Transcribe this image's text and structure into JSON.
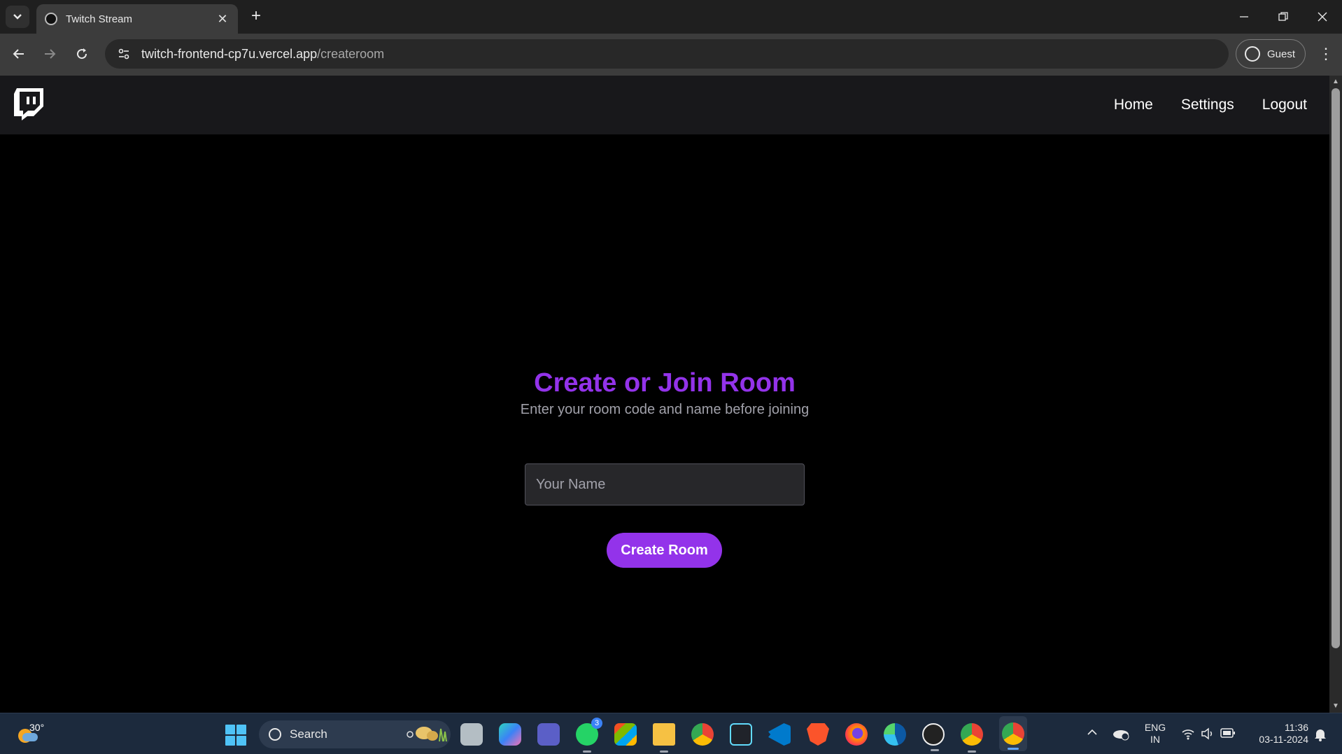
{
  "browser": {
    "tab_title": "Twitch Stream",
    "url_host": "twitch-frontend-cp7u.vercel.app",
    "url_path": "/createroom",
    "profile_label": "Guest"
  },
  "app": {
    "nav_links": [
      "Home",
      "Settings",
      "Logout"
    ],
    "heading": "Create or Join Room",
    "subheading": "Enter your room code and name before joining",
    "name_placeholder": "Your Name",
    "name_value": "",
    "create_button": "Create Room",
    "accent_color": "#9333ea"
  },
  "taskbar": {
    "weather_temp": "30°",
    "search_label": "Search",
    "whatsapp_badge": "3",
    "lang_line1": "ENG",
    "lang_line2": "IN",
    "time": "11:36",
    "date": "03-11-2024",
    "apps": [
      "task-view-icon",
      "copilot-icon",
      "teams-icon",
      "whatsapp-icon",
      "store-icon",
      "file-explorer-icon",
      "chrome-icon",
      "react-devtools-icon",
      "vscode-icon",
      "brave-icon",
      "firefox-icon",
      "edge-icon",
      "media-player-icon",
      "chrome-dev-icon",
      "chrome-active-icon"
    ]
  }
}
